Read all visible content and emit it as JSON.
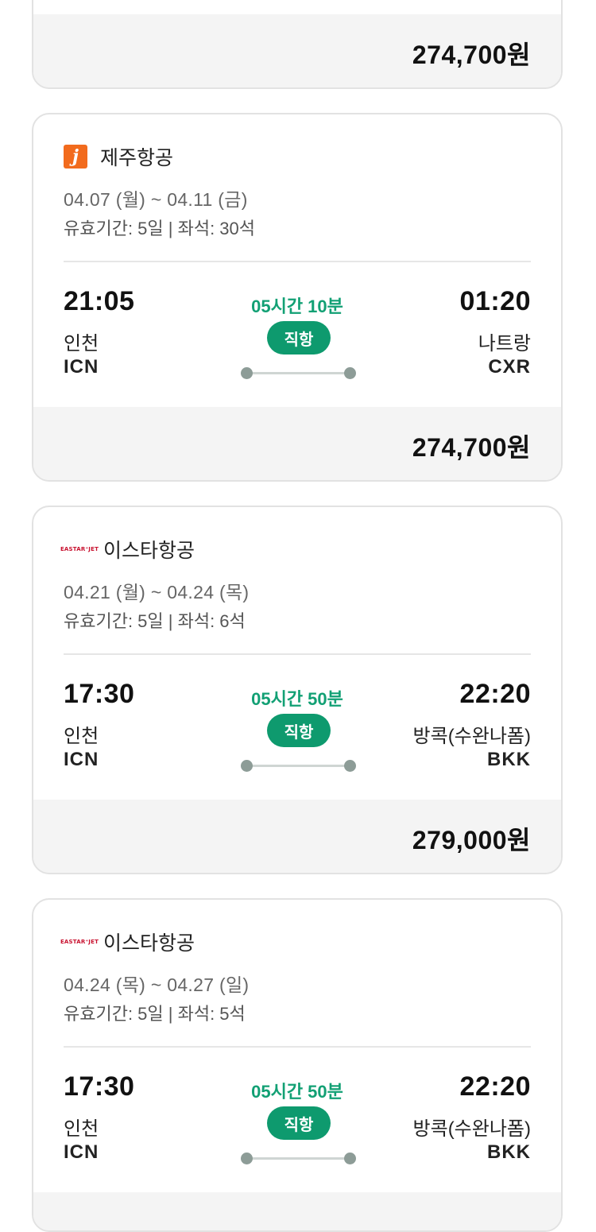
{
  "cards": [
    {
      "price": "274,700원"
    },
    {
      "airline": "제주항공",
      "logo": "jeju-air-logo",
      "logo_letter": "j",
      "dates": "04.07 (월) ~ 04.11 (금)",
      "meta": "유효기간: 5일 | 좌석: 30석",
      "dep_time": "21:05",
      "dep_city": "인천",
      "dep_code": "ICN",
      "duration": "05시간 10분",
      "flight_type": "직항",
      "arr_time": "01:20",
      "arr_city": "나트랑",
      "arr_code": "CXR",
      "price": "274,700원"
    },
    {
      "airline": "이스타항공",
      "logo": "eastar-jet-logo",
      "logo_text": "EASTAR⁺JET",
      "dates": "04.21 (월) ~ 04.24 (목)",
      "meta": "유효기간: 5일 | 좌석: 6석",
      "dep_time": "17:30",
      "dep_city": "인천",
      "dep_code": "ICN",
      "duration": "05시간 50분",
      "flight_type": "직항",
      "arr_time": "22:20",
      "arr_city": "방콕(수완나폼)",
      "arr_code": "BKK",
      "price": "279,000원"
    },
    {
      "airline": "이스타항공",
      "logo": "eastar-jet-logo",
      "logo_text": "EASTAR⁺JET",
      "dates": "04.24 (목) ~ 04.27 (일)",
      "meta": "유효기간: 5일 | 좌석: 5석",
      "dep_time": "17:30",
      "dep_city": "인천",
      "dep_code": "ICN",
      "duration": "05시간 50분",
      "flight_type": "직항",
      "arr_time": "22:20",
      "arr_city": "방콕(수완나폼)",
      "arr_code": "BKK"
    }
  ],
  "colors": {
    "accent_green": "#12a074",
    "badge_green": "#0e9a6e",
    "jeju_orange": "#f26b1d",
    "eastar_red": "#c8102e"
  }
}
